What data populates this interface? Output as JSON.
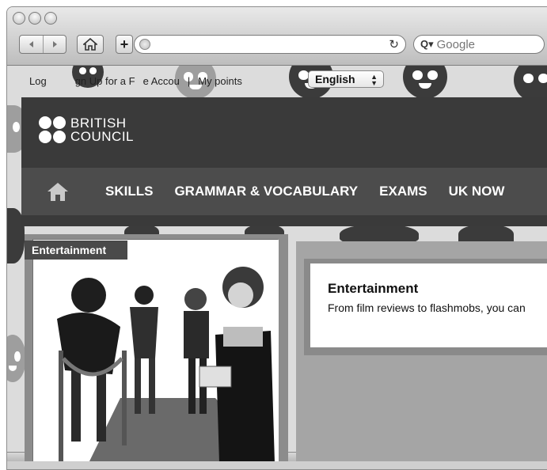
{
  "browser": {
    "search": {
      "placeholder": "Google"
    },
    "icons": {
      "back": "back-arrow-icon",
      "forward": "forward-arrow-icon",
      "home": "home-icon",
      "add": "add-bookmark-icon",
      "globe": "globe-icon",
      "reload": "reload-icon",
      "search": "search-icon"
    }
  },
  "site": {
    "topbar": {
      "login_label": "Log",
      "signup_label": "gn Up for a F",
      "signup_tail": "e Accou",
      "separator": "|",
      "points_label": "My points"
    },
    "language": {
      "selected": "English"
    },
    "logo": {
      "line1": "BRITISH",
      "line2": "COUNCIL"
    },
    "nav": {
      "items": [
        {
          "label": "SKILLS"
        },
        {
          "label": "GRAMMAR & VOCABULARY"
        },
        {
          "label": "EXAMS"
        },
        {
          "label": "UK NOW"
        }
      ]
    },
    "feature": {
      "tag": "Entertainment",
      "title": "Entertainment",
      "text": "From film reviews to flashmobs, you can"
    }
  },
  "colors": {
    "header_bg": "#3a3a3a",
    "nav_bg": "#4c4c4c",
    "feature_bg": "#a5a5a5"
  }
}
